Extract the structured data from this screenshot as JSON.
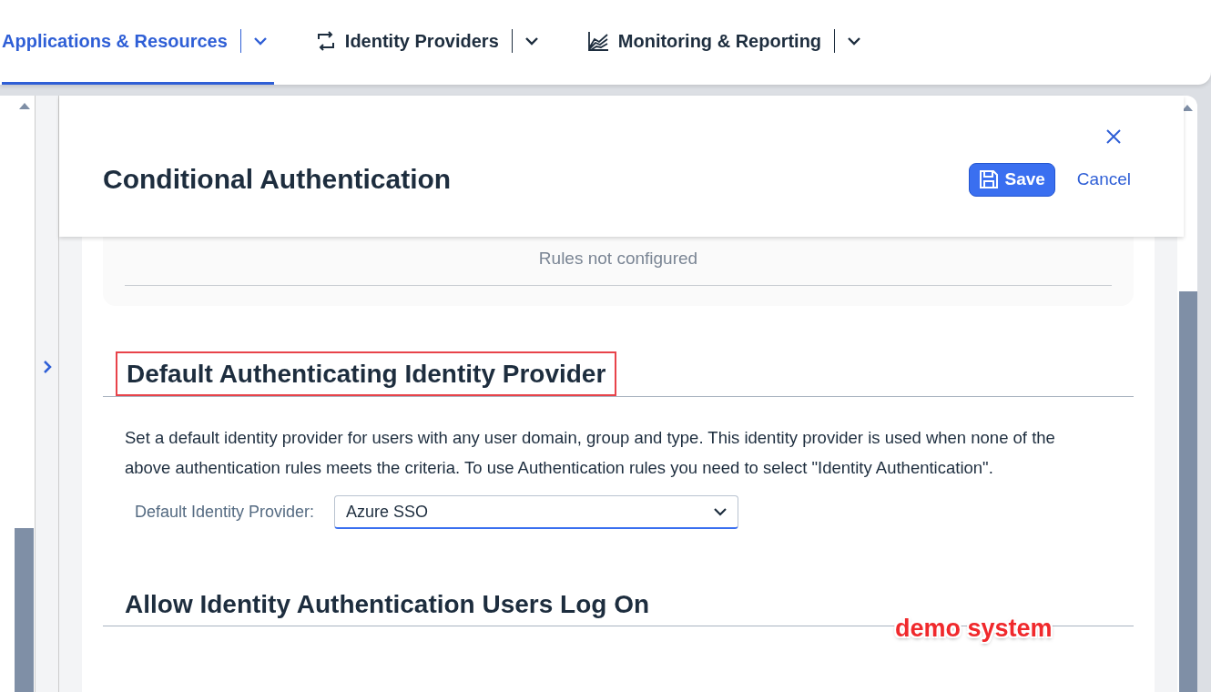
{
  "nav_tabs": [
    {
      "label": "Applications & Resources",
      "kind": "plain",
      "selected": true
    },
    {
      "label": "Identity Providers",
      "kind": "swap",
      "selected": false
    },
    {
      "label": "Monitoring & Reporting",
      "kind": "chart",
      "selected": false
    }
  ],
  "dialog": {
    "title": "Conditional Authentication",
    "buttons": [
      {
        "label": "Save",
        "kind": "primary"
      },
      {
        "label": "Cancel",
        "kind": "link"
      }
    ]
  },
  "rules_panel": {
    "message": "Rules not configured"
  },
  "sections": [
    {
      "heading": "Default Authenticating Identity Provider",
      "highlighted": true,
      "description": "Set a default identity provider for users with any user domain, group and type. This identity provider is used when none of the above authentication rules meets the criteria. To use Authentication rules you need to select \"Identity Authentication\".",
      "field": {
        "label": "Default Identity Provider:",
        "value": "Azure SSO"
      }
    },
    {
      "heading": "Allow Identity Authentication Users Log On",
      "highlighted": false
    }
  ],
  "annotation": "demo system"
}
